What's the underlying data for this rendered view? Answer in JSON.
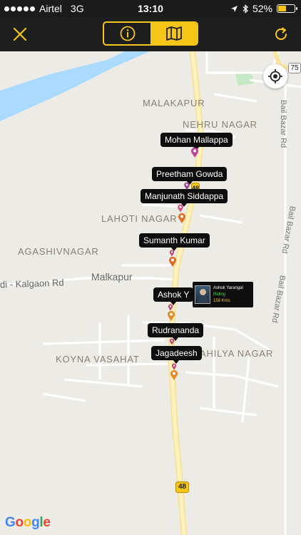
{
  "status_bar": {
    "carrier": "Airtel",
    "network": "3G",
    "time": "13:10",
    "battery_percent_label": "52%",
    "battery_level": 0.52
  },
  "nav": {
    "close_icon": "close-icon",
    "info_icon": "info-icon",
    "map_icon": "map-icon",
    "refresh_icon": "refresh-icon",
    "accent_color": "#f5c518"
  },
  "map": {
    "places": {
      "malakapur": "MALAKAPUR",
      "nehru_nagar": "NEHRU NAGAR",
      "lahoti_nagar": "LAHOTI NAGAR",
      "agashivnagar": "AGASHIVNAGAR",
      "koyna_vasahat": "KOYNA VASAHAT",
      "ahilya_nagar": "AHILYA NAGAR"
    },
    "roads": {
      "malkapur": "Malkapur",
      "kalgaon_rd": "di - Kalgaon Rd",
      "bail_bazar_rd_1": "Bail Bazar Rd",
      "bail_bazar_rd_2": "Bail Bazar Rd",
      "bail_bazar_rd_3": "Bail Bazar Rd"
    },
    "shields": {
      "nh48_top": "48",
      "nh48_bottom": "48",
      "sh75": "75"
    },
    "google": [
      "G",
      "o",
      "o",
      "g",
      "l",
      "e"
    ]
  },
  "riders": [
    {
      "name": "Mohan Mallappa"
    },
    {
      "name": "Preetham Gowda"
    },
    {
      "name": "Manjunath Siddappa"
    },
    {
      "name": "Sumanth Kumar"
    },
    {
      "name": "Ashok Y"
    },
    {
      "name": "Rudrananda"
    },
    {
      "name": "Jagadeesh"
    }
  ],
  "rider_card": {
    "name": "Ashok Yarangal",
    "status": "Riding",
    "distance": "158 Kms"
  }
}
